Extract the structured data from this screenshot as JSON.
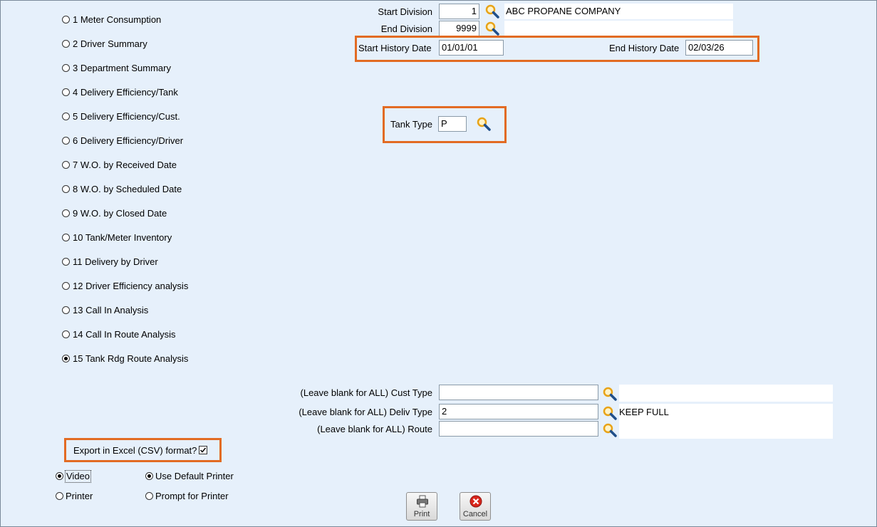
{
  "reports": [
    {
      "label": "1 Meter Consumption",
      "selected": false
    },
    {
      "label": "2 Driver Summary",
      "selected": false
    },
    {
      "label": "3 Department Summary",
      "selected": false
    },
    {
      "label": "4 Delivery Efficiency/Tank",
      "selected": false
    },
    {
      "label": "5 Delivery Efficiency/Cust.",
      "selected": false
    },
    {
      "label": "6 Delivery Efficiency/Driver",
      "selected": false
    },
    {
      "label": "7 W.O. by Received Date",
      "selected": false
    },
    {
      "label": "8 W.O. by Scheduled Date",
      "selected": false
    },
    {
      "label": "9 W.O. by Closed Date",
      "selected": false
    },
    {
      "label": "10 Tank/Meter Inventory",
      "selected": false
    },
    {
      "label": "11 Delivery by Driver",
      "selected": false
    },
    {
      "label": "12 Driver Efficiency analysis",
      "selected": false
    },
    {
      "label": "13 Call In Analysis",
      "selected": false
    },
    {
      "label": "14 Call In Route Analysis",
      "selected": false
    },
    {
      "label": "15 Tank Rdg Route Analysis",
      "selected": true
    }
  ],
  "division": {
    "start_label": "Start Division",
    "start_value": "1",
    "start_name": "ABC PROPANE COMPANY",
    "end_label": "End Division",
    "end_value": "9999"
  },
  "history": {
    "start_label": "Start History Date",
    "start_value": "01/01/01",
    "end_label": "End History Date",
    "end_value": "02/03/26"
  },
  "tank_type": {
    "label": "Tank Type",
    "value": "P"
  },
  "filters": {
    "cust_type_label": "(Leave blank for ALL) Cust Type",
    "cust_type_value": "",
    "deliv_type_label": "(Leave blank for ALL) Deliv Type",
    "deliv_type_value": "2",
    "deliv_type_desc": "KEEP FULL",
    "route_label": "(Leave blank for ALL) Route",
    "route_value": ""
  },
  "export": {
    "label": "Export in Excel (CSV) format?",
    "checked": true
  },
  "output": {
    "video_label": "Video",
    "printer_label": "Printer",
    "default_printer_label": "Use Default Printer",
    "prompt_printer_label": "Prompt for Printer",
    "selected_destination": "Video",
    "selected_printer_mode": "Use Default Printer"
  },
  "buttons": {
    "print_label": "Print",
    "cancel_label": "Cancel"
  },
  "colors": {
    "background": "#e6f0fb",
    "highlight": "#e26b23",
    "cancel_red": "#d9261c",
    "magnifier_gold": "#e8a317"
  }
}
